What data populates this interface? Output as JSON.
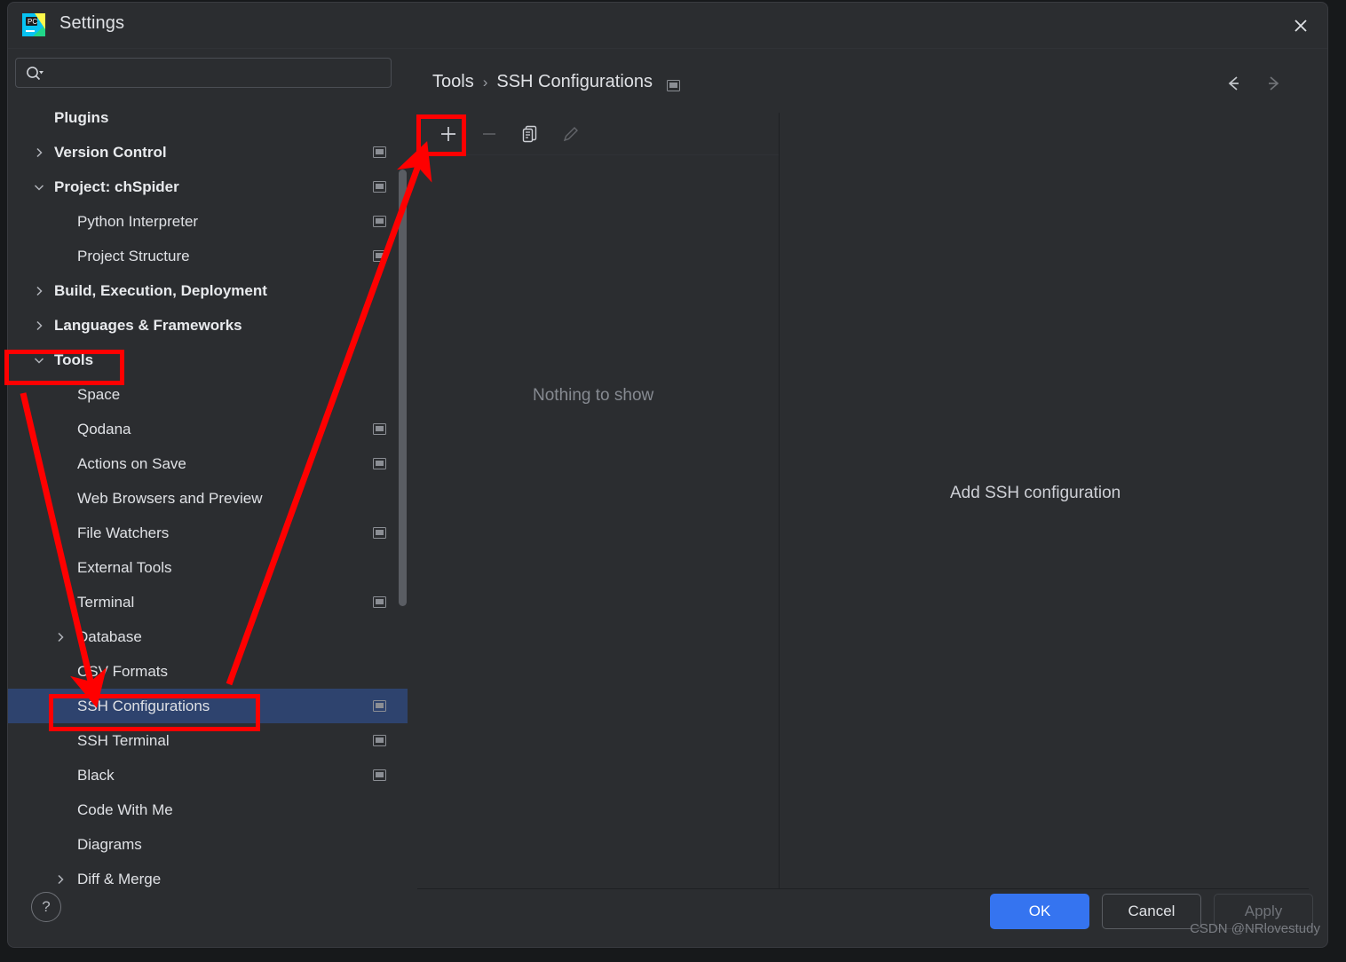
{
  "window": {
    "title": "Settings",
    "app_icon": "pycharm-logo-icon",
    "close_icon": "close-icon"
  },
  "search": {
    "value": "",
    "placeholder": "",
    "icon": "search-icon"
  },
  "sidebar": {
    "items": [
      {
        "label": "Plugins",
        "level": 0,
        "bold": true,
        "chevron": "none",
        "badge": false,
        "selected": false
      },
      {
        "label": "Version Control",
        "level": 0,
        "bold": true,
        "chevron": "right",
        "badge": true,
        "selected": false
      },
      {
        "label": "Project: chSpider",
        "level": 0,
        "bold": true,
        "chevron": "down",
        "badge": true,
        "selected": false
      },
      {
        "label": "Python Interpreter",
        "level": 1,
        "bold": false,
        "chevron": "none",
        "badge": true,
        "selected": false
      },
      {
        "label": "Project Structure",
        "level": 1,
        "bold": false,
        "chevron": "none",
        "badge": true,
        "selected": false
      },
      {
        "label": "Build, Execution, Deployment",
        "level": 0,
        "bold": true,
        "chevron": "right",
        "badge": false,
        "selected": false
      },
      {
        "label": "Languages & Frameworks",
        "level": 0,
        "bold": true,
        "chevron": "right",
        "badge": false,
        "selected": false
      },
      {
        "label": "Tools",
        "level": 0,
        "bold": true,
        "chevron": "down",
        "badge": false,
        "selected": false
      },
      {
        "label": "Space",
        "level": 1,
        "bold": false,
        "chevron": "none",
        "badge": false,
        "selected": false
      },
      {
        "label": "Qodana",
        "level": 1,
        "bold": false,
        "chevron": "none",
        "badge": true,
        "selected": false
      },
      {
        "label": "Actions on Save",
        "level": 1,
        "bold": false,
        "chevron": "none",
        "badge": true,
        "selected": false
      },
      {
        "label": "Web Browsers and Preview",
        "level": 1,
        "bold": false,
        "chevron": "none",
        "badge": false,
        "selected": false
      },
      {
        "label": "File Watchers",
        "level": 1,
        "bold": false,
        "chevron": "none",
        "badge": true,
        "selected": false
      },
      {
        "label": "External Tools",
        "level": 1,
        "bold": false,
        "chevron": "none",
        "badge": false,
        "selected": false
      },
      {
        "label": "Terminal",
        "level": 1,
        "bold": false,
        "chevron": "none",
        "badge": true,
        "selected": false
      },
      {
        "label": "Database",
        "level": 1,
        "bold": false,
        "chevron": "right",
        "badge": false,
        "selected": false
      },
      {
        "label": "CSV Formats",
        "level": 1,
        "bold": false,
        "chevron": "none",
        "badge": false,
        "selected": false
      },
      {
        "label": "SSH Configurations",
        "level": 1,
        "bold": false,
        "chevron": "none",
        "badge": true,
        "selected": true
      },
      {
        "label": "SSH Terminal",
        "level": 1,
        "bold": false,
        "chevron": "none",
        "badge": true,
        "selected": false
      },
      {
        "label": "Black",
        "level": 1,
        "bold": false,
        "chevron": "none",
        "badge": true,
        "selected": false
      },
      {
        "label": "Code With Me",
        "level": 1,
        "bold": false,
        "chevron": "none",
        "badge": false,
        "selected": false
      },
      {
        "label": "Diagrams",
        "level": 1,
        "bold": false,
        "chevron": "none",
        "badge": false,
        "selected": false
      },
      {
        "label": "Diff & Merge",
        "level": 1,
        "bold": false,
        "chevron": "right",
        "badge": false,
        "selected": false
      }
    ]
  },
  "breadcrumb": {
    "parent": "Tools",
    "separator": "›",
    "current": "SSH Configurations",
    "badge_icon": "screen-badge-icon"
  },
  "navigation": {
    "back_icon": "arrow-left-icon",
    "forward_icon": "arrow-right-icon"
  },
  "toolbar": {
    "add_icon": "plus-icon",
    "remove_icon": "minus-icon",
    "copy_icon": "copy-icon",
    "edit_icon": "pencil-icon"
  },
  "main": {
    "empty_list_text": "Nothing to show",
    "detail_text": "Add SSH configuration"
  },
  "footer": {
    "help_label": "?",
    "ok_label": "OK",
    "cancel_label": "Cancel",
    "apply_label": "Apply",
    "watermark": "CSDN @NRlovestudy"
  },
  "annotations": {
    "color": "#ff0000",
    "boxes": [
      "tools-tree-item",
      "ssh-configurations-tree-item",
      "add-configuration-button"
    ],
    "arrows": [
      "tools-to-ssh-configurations",
      "ssh-configurations-to-add-button"
    ]
  },
  "colors": {
    "accent_blue": "#3574f0",
    "selection_blue": "#2e436e",
    "dialog_bg": "#2b2d30",
    "annotation_red": "#ff0000"
  }
}
